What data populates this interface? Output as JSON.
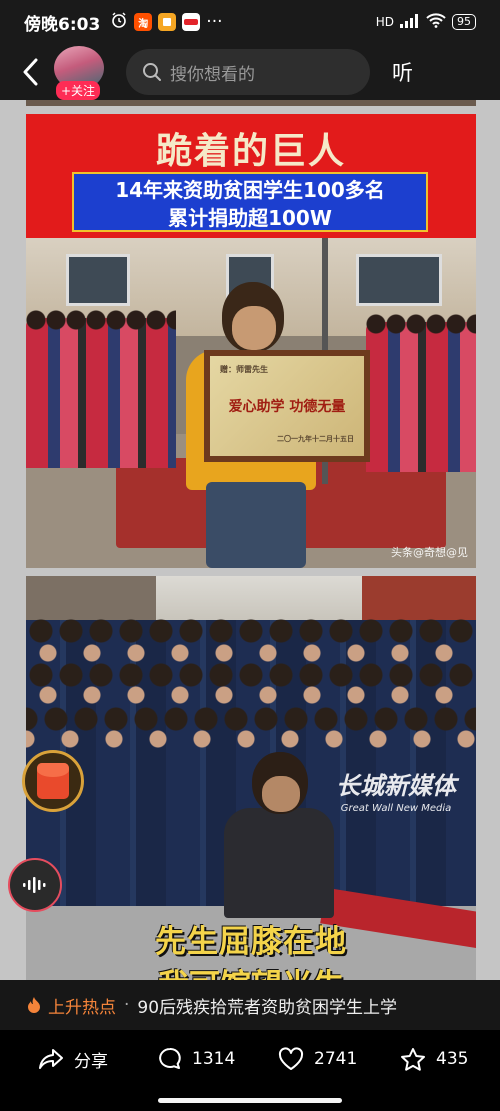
{
  "status_bar": {
    "time": "傍晚6:03",
    "app_icons": [
      "alarm-icon",
      "taobao-icon",
      "notes-icon",
      "app-icon"
    ],
    "taobao_glyph": "淘",
    "more": "···",
    "network": "HD",
    "battery": "95"
  },
  "top_nav": {
    "follow_label": "+关注",
    "search_placeholder": "搜你想看的",
    "listen_label": "听"
  },
  "card1": {
    "title": "跪着的巨人",
    "subtitle_line1": "14年来资助贫困学生100多名",
    "subtitle_line2": "累计捐助超100W",
    "plaque_top": "赠：师雷先生",
    "plaque_text": "爱心助学 功德无量",
    "plaque_bottom": "二〇一九年十二月十五日",
    "watermark": "头条@奇想@见"
  },
  "card2": {
    "watermark": "长城新媒体",
    "watermark_en": "Great Wall New Media",
    "caption_line1": "先生屈膝在地",
    "caption_line2": "我可馆望光生"
  },
  "hot_topic": {
    "label": "上升热点",
    "separator": "·",
    "text": "90后残疾拾荒者资助贫困学生上学"
  },
  "actions": {
    "share_label": "分享",
    "comments": "1314",
    "likes": "2741",
    "favorites": "435"
  },
  "colors": {
    "accent_red": "#fe2c55",
    "hot_orange": "#f5843a",
    "card_red": "#e21b1b",
    "banner_blue": "#1c3fcf",
    "caption_yellow": "#f4d44a"
  }
}
